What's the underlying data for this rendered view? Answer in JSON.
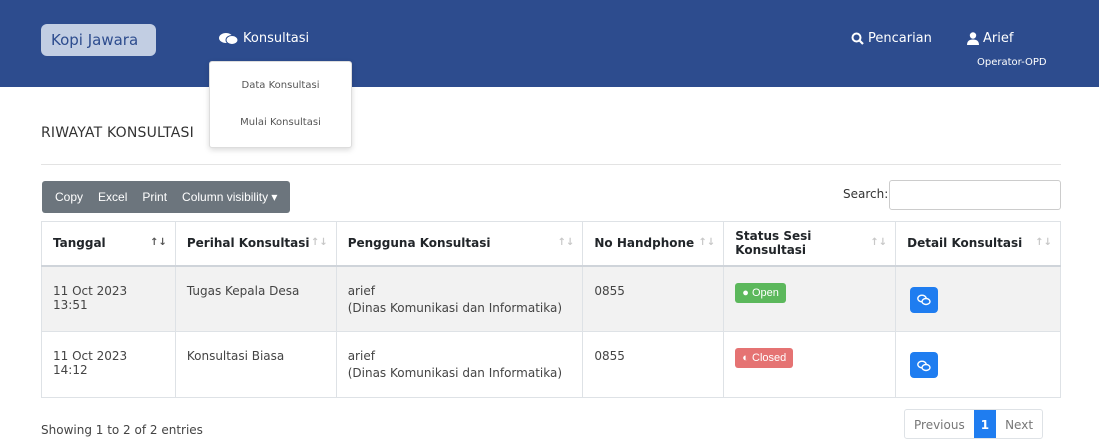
{
  "navbar": {
    "brand": "Kopi Jawara",
    "konsultasi": "Konsultasi",
    "search": "Pencarian",
    "user_name": "Arief",
    "user_role": "Operator-OPD"
  },
  "dropdown": {
    "items": [
      "Data Konsultasi",
      "Mulai Konsultasi"
    ]
  },
  "page": {
    "title": "RIWAYAT KONSULTASI"
  },
  "toolbar": {
    "copy": "Copy",
    "excel": "Excel",
    "print": "Print",
    "column_visibility": "Column visibility ▾",
    "search_label": "Search:",
    "search_value": ""
  },
  "table": {
    "headers": [
      "Tanggal",
      "Perihal Konsultasi",
      "Pengguna Konsultasi",
      "No Handphone",
      "Status Sesi Konsultasi",
      "Detail Konsultasi"
    ],
    "rows": [
      {
        "tanggal": "11 Oct 2023 13:51",
        "perihal": "Tugas Kepala Desa",
        "pengguna": "arief",
        "instansi": "(Dinas Komunikasi dan Informatika)",
        "hp": "0855",
        "status": "Open"
      },
      {
        "tanggal": "11 Oct 2023 14:12",
        "perihal": "Konsultasi Biasa",
        "pengguna": "arief",
        "instansi": "(Dinas Komunikasi dan Informatika)",
        "hp": "0855",
        "status": "Closed"
      }
    ]
  },
  "footer": {
    "info": "Showing 1 to 2 of 2 entries",
    "previous": "Previous",
    "page": "1",
    "next": "Next"
  },
  "colors": {
    "navbar": "#2d4c8e",
    "open": "#5cb85c",
    "closed": "#e57373",
    "primary": "#1f7df0"
  }
}
